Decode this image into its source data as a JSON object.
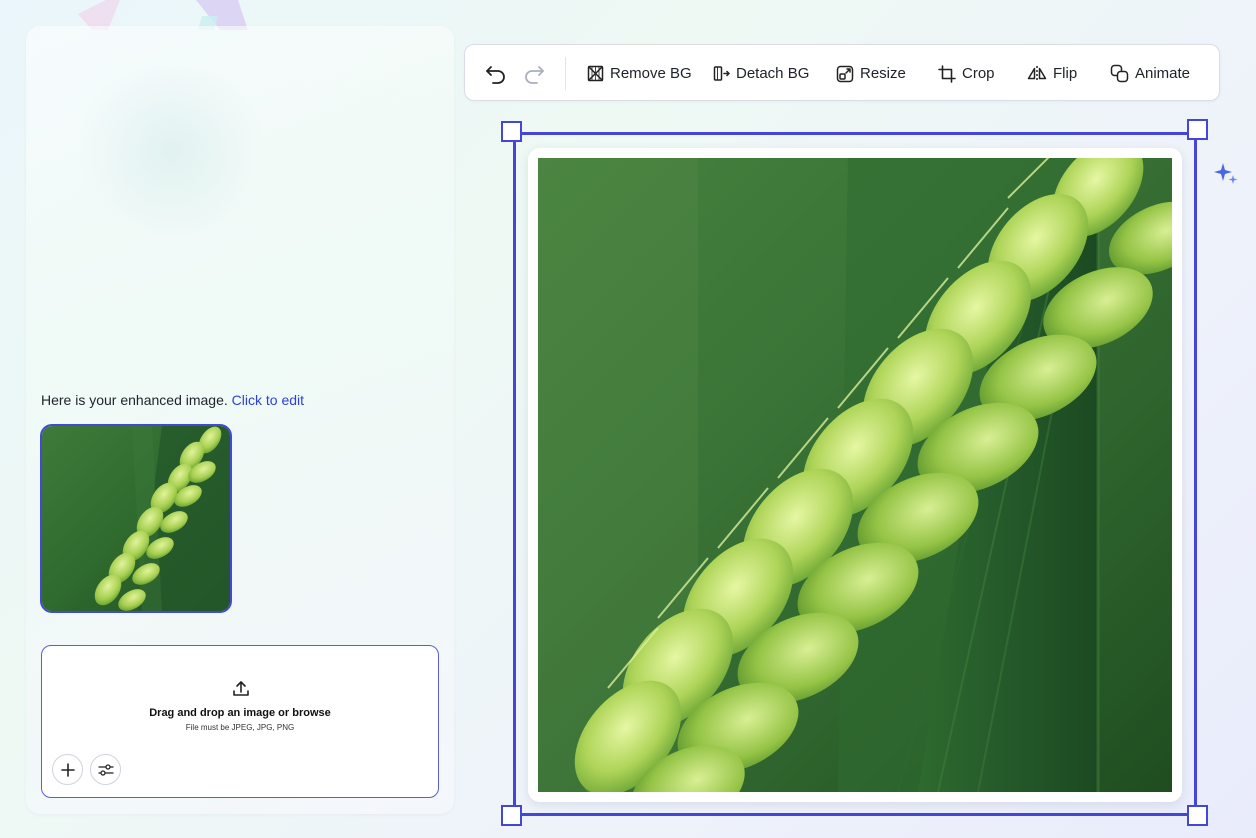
{
  "chat": {
    "message_text": "Here is your enhanced image.",
    "message_link": "Click to edit"
  },
  "upload": {
    "title": "Drag and drop an image or browse",
    "subtitle": "File must be JPEG, JPG, PNG"
  },
  "toolbar": {
    "remove_bg": "Remove BG",
    "detach_bg": "Detach BG",
    "resize": "Resize",
    "crop": "Crop",
    "flip": "Flip",
    "animate": "Animate"
  },
  "colors": {
    "accent": "#4346d8",
    "link": "#2f3fd8"
  }
}
